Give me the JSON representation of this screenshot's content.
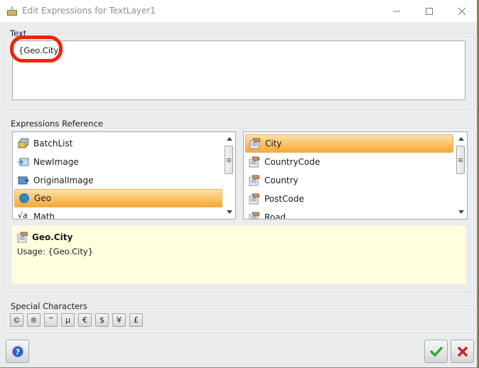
{
  "window": {
    "title": "Edit Expressions for TextLayer1",
    "controls": [
      "minimize",
      "maximize",
      "close"
    ]
  },
  "text_section": {
    "label": "Text",
    "value": "{Geo.City}"
  },
  "reference_section": {
    "label": "Expressions Reference",
    "categories": [
      {
        "label": "BatchList",
        "icon": "batchlist-icon"
      },
      {
        "label": "NewImage",
        "icon": "newimage-icon"
      },
      {
        "label": "OriginalImage",
        "icon": "originalimage-icon"
      },
      {
        "label": "Geo",
        "icon": "globe-icon",
        "selected": true
      },
      {
        "label": "Math",
        "icon": "sqrt-icon"
      }
    ],
    "members": [
      {
        "label": "City",
        "selected": true
      },
      {
        "label": "CountryCode"
      },
      {
        "label": "Country"
      },
      {
        "label": "PostCode"
      },
      {
        "label": "Road"
      }
    ],
    "description": {
      "title": "Geo.City",
      "usage": "Usage: {Geo.City}"
    }
  },
  "special_characters": {
    "label": "Special Characters",
    "chars": [
      "©",
      "®",
      "™",
      "µ",
      "€",
      "$",
      "¥",
      "£"
    ]
  },
  "footer": {
    "help": "help",
    "ok": "ok",
    "cancel": "cancel"
  },
  "colors": {
    "selection": "#f9a738",
    "annotation": "#f02400",
    "description_bg": "#ffffdf"
  }
}
